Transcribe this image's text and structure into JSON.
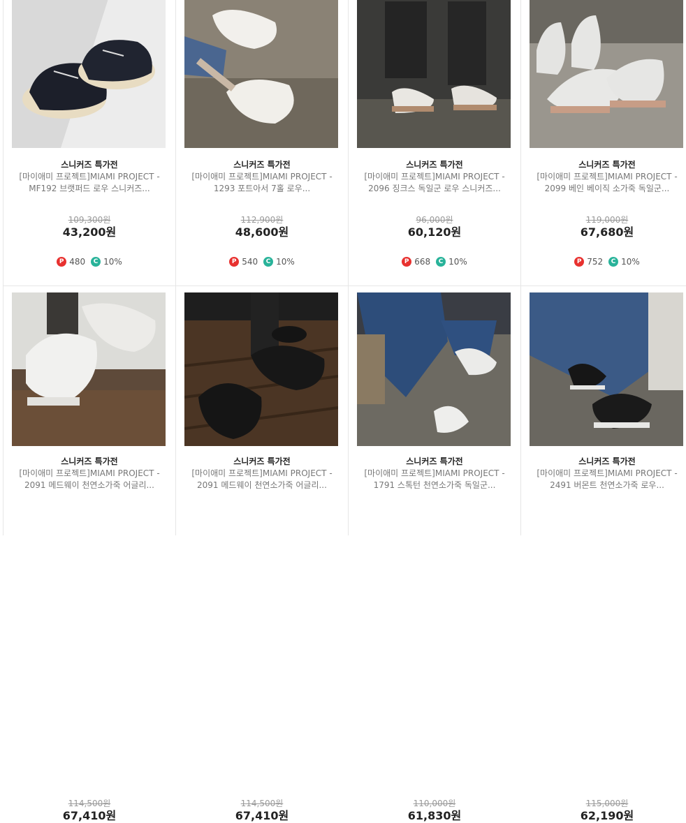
{
  "products": [
    {
      "category": "스니커즈 특가전",
      "name_line1": "[마이애미 프로젝트]MIAMI PROJECT -",
      "name_line2": "MF192 브랫퍼드 로우 스니커즈...",
      "original_price": "109,300원",
      "sale_price": "43,200원",
      "point": "480",
      "coupon": "10%",
      "image": "black-canvas-sneakers"
    },
    {
      "category": "스니커즈 특가전",
      "name_line1": "[마이애미 프로젝트]MIAMI PROJECT -",
      "name_line2": "1293 포트아서 7홀 로우...",
      "original_price": "112,900원",
      "sale_price": "48,600원",
      "point": "540",
      "coupon": "10%",
      "image": "white-leather-sneakers"
    },
    {
      "category": "스니커즈 특가전",
      "name_line1": "[마이애미 프로젝트]MIAMI PROJECT -",
      "name_line2": "2096 징크스 독일군 로우 스니커즈...",
      "original_price": "96,000원",
      "sale_price": "60,120원",
      "point": "668",
      "coupon": "10%",
      "image": "german-army-trainers-worn"
    },
    {
      "category": "스니커즈 특가전",
      "name_line1": "[마이애미 프로젝트]MIAMI PROJECT -",
      "name_line2": "2099 베인 베이직 소가죽 독일군...",
      "original_price": "119,000원",
      "sale_price": "67,680원",
      "point": "752",
      "coupon": "10%",
      "image": "german-army-trainers-pair"
    },
    {
      "category": "스니커즈 특가전",
      "name_line1": "[마이애미 프로젝트]MIAMI PROJECT -",
      "name_line2": "2091 메드웨이 천연소가죽 어글리...",
      "original_price": "114,500원",
      "sale_price": "67,410원",
      "image": "white-chunky-sneakers"
    },
    {
      "category": "스니커즈 특가전",
      "name_line1": "[마이애미 프로젝트]MIAMI PROJECT -",
      "name_line2": "2091 메드웨이 천연소가죽 어글리...",
      "original_price": "114,500원",
      "sale_price": "67,410원",
      "image": "black-chunky-sneakers"
    },
    {
      "category": "스니커즈 특가전",
      "name_line1": "[마이애미 프로젝트]MIAMI PROJECT -",
      "name_line2": "1791 스톡턴 천연소가죽 독일군...",
      "original_price": "110,000원",
      "sale_price": "61,830원",
      "image": "white-trainers-denim"
    },
    {
      "category": "스니커즈 특가전",
      "name_line1": "[마이애미 프로젝트]MIAMI PROJECT -",
      "name_line2": "2491 버몬트 천연소가죽 로우...",
      "original_price": "115,000원",
      "sale_price": "62,190원",
      "image": "black-leather-sneakers-denim"
    }
  ],
  "badges": {
    "point": "P",
    "coupon": "C"
  },
  "colors": {
    "point_badge": "#e8312f",
    "coupon_badge": "#29b39a"
  }
}
